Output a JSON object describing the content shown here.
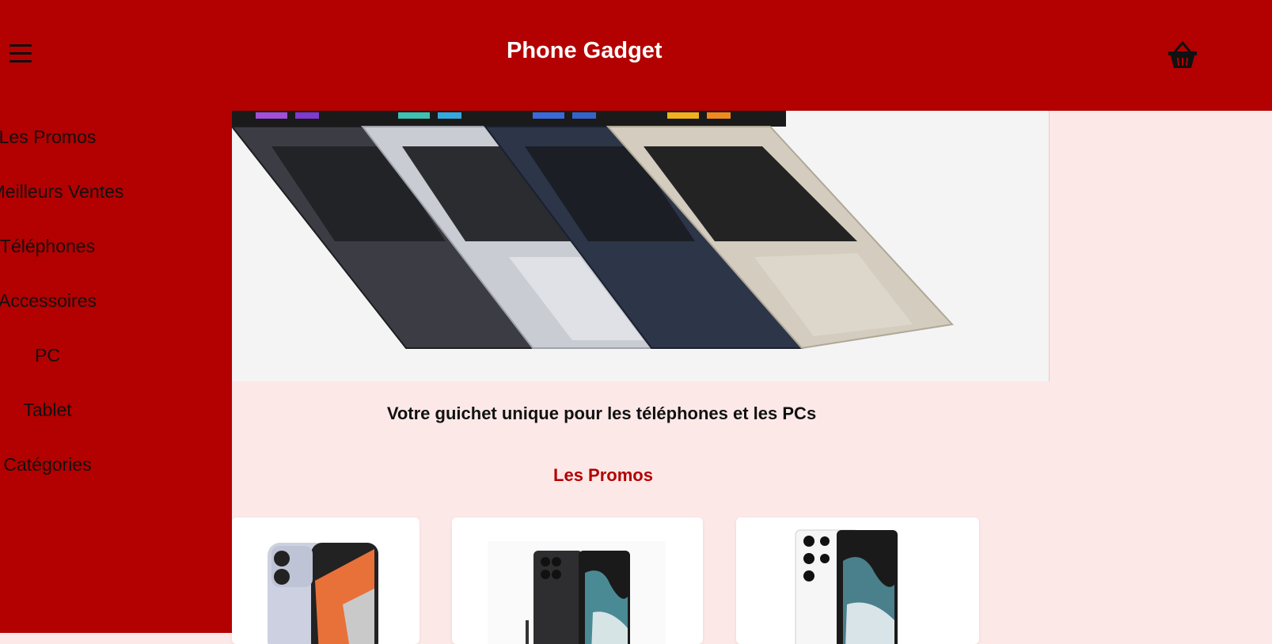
{
  "header": {
    "title": "Phone Gadget",
    "menu_icon": "hamburger-menu-icon",
    "cart_icon": "shopping-basket-icon",
    "background_color": "#b30000"
  },
  "sidebar": {
    "items": [
      {
        "label": "Les Promos"
      },
      {
        "label": "Meilleurs Ventes"
      },
      {
        "label": "Téléphones"
      },
      {
        "label": "Accessoires"
      },
      {
        "label": "PC"
      },
      {
        "label": "Tablet"
      },
      {
        "label": "Catégories"
      }
    ]
  },
  "main": {
    "hero_image": "laptops-banner-image",
    "tagline": "Votre guichet unique pour les téléphones et les PCs",
    "promos_heading": "Les Promos",
    "promo_cards": [
      {
        "image": "phone-redmi-image"
      },
      {
        "image": "phone-galaxy-s22-ultra-black-image"
      },
      {
        "image": "phone-galaxy-s22-ultra-white-image"
      }
    ]
  },
  "colors": {
    "accent": "#b30000",
    "page_background": "#fde8e8",
    "heading_accent": "#b30000"
  }
}
